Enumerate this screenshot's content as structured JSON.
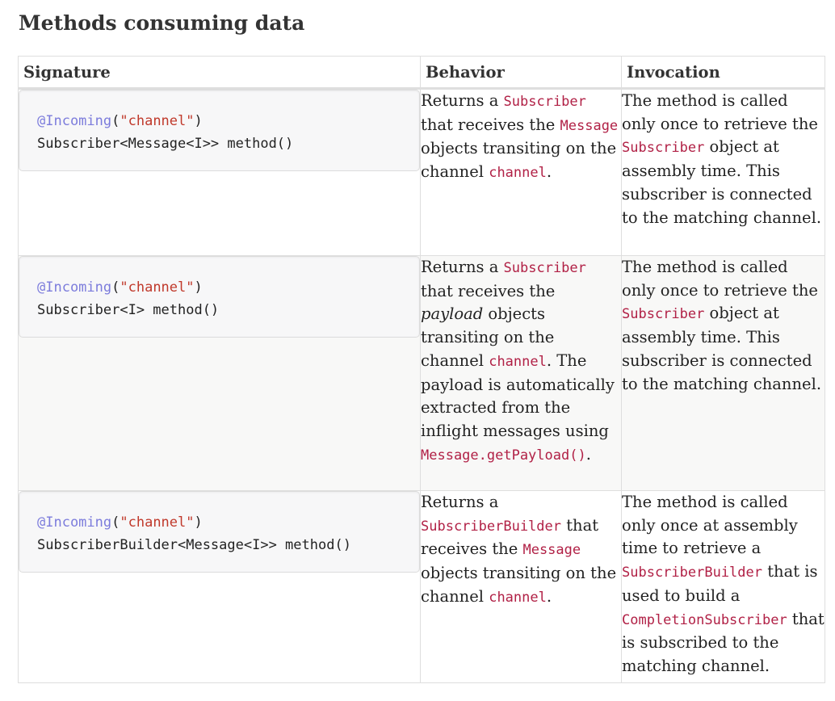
{
  "heading": "Methods consuming data",
  "columns": [
    "Signature",
    "Behavior",
    "Invocation"
  ],
  "rows": [
    {
      "signature": {
        "annotation": "@Incoming",
        "open": "(",
        "arg": "\"channel\"",
        "close": ")",
        "method": "Subscriber<Message<I>> method()"
      },
      "behavior": [
        {
          "t": "Returns a "
        },
        {
          "c": "Subscriber"
        },
        {
          "t": " that receives the "
        },
        {
          "c": "Message"
        },
        {
          "t": " objects transiting on the channel "
        },
        {
          "c": "channel"
        },
        {
          "t": "."
        }
      ],
      "invocation": [
        {
          "t": "The method is called only once to retrieve the "
        },
        {
          "c": "Subscriber"
        },
        {
          "t": " object at assembly time. This subscriber is connected to the matching channel."
        }
      ]
    },
    {
      "signature": {
        "annotation": "@Incoming",
        "open": "(",
        "arg": "\"channel\"",
        "close": ")",
        "method": "Subscriber<I> method()"
      },
      "behavior": [
        {
          "t": "Returns a "
        },
        {
          "c": "Subscriber"
        },
        {
          "t": " that receives the "
        },
        {
          "e": "payload"
        },
        {
          "t": " objects transiting on the channel "
        },
        {
          "c": "channel"
        },
        {
          "t": ". The payload is automatically extracted from the inflight messages using "
        },
        {
          "c": "Message.getPayload()"
        },
        {
          "t": "."
        }
      ],
      "invocation": [
        {
          "t": "The method is called only once to retrieve the "
        },
        {
          "c": "Subscriber"
        },
        {
          "t": " object at assembly time. This subscriber is connected to the matching channel."
        }
      ]
    },
    {
      "signature": {
        "annotation": "@Incoming",
        "open": "(",
        "arg": "\"channel\"",
        "close": ")",
        "method": "SubscriberBuilder<Message<I>> method()"
      },
      "behavior": [
        {
          "t": "Returns a "
        },
        {
          "c": "SubscriberBuilder"
        },
        {
          "t": " that receives the "
        },
        {
          "c": "Message"
        },
        {
          "t": " objects transiting on the channel "
        },
        {
          "c": "channel"
        },
        {
          "t": "."
        }
      ],
      "invocation": [
        {
          "t": "The method is called only once at assembly time to retrieve a "
        },
        {
          "c": "SubscriberBuilder"
        },
        {
          "t": " that is used to build a "
        },
        {
          "c": "CompletionSubscriber"
        },
        {
          "t": " that is subscribed to the matching channel."
        }
      ]
    }
  ]
}
